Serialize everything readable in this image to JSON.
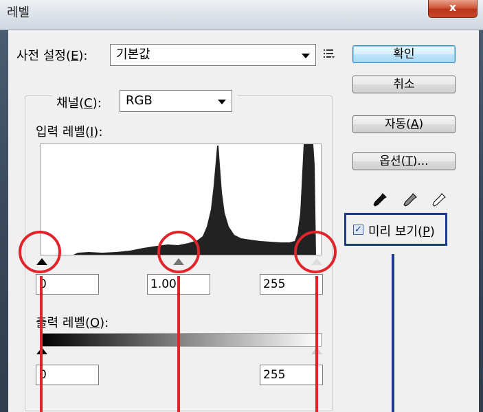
{
  "window": {
    "title": "레벨",
    "close_label": "x"
  },
  "preset": {
    "label": "사전 설정(",
    "label_key": "E",
    "label_end": "):",
    "value": "기본값"
  },
  "channel": {
    "label": "채널(",
    "label_key": "C",
    "label_end": "):",
    "value": "RGB"
  },
  "input_levels": {
    "label": "입력 레벨(",
    "label_key": "I",
    "label_end": "):",
    "black": "0",
    "gamma": "1.00",
    "white": "255"
  },
  "output_levels": {
    "label": "출력 레벨(",
    "label_key": "O",
    "label_end": "):",
    "black": "0",
    "white": "255"
  },
  "buttons": {
    "ok": "확인",
    "cancel": "취소",
    "auto": "자동(",
    "auto_key": "A",
    "auto_end": ")",
    "options": "옵션(",
    "options_key": "T",
    "options_end": ")..."
  },
  "preview": {
    "label": "미리 보기(",
    "label_key": "P",
    "label_end": ")",
    "checked": true
  },
  "icons": {
    "menu": "list-menu-icon",
    "eyedroppers": [
      "black-eyedropper-icon",
      "gray-eyedropper-icon",
      "white-eyedropper-icon"
    ]
  },
  "colors": {
    "annotation_red": "#e0242a",
    "annotation_blue": "#1f3a8c",
    "default_button": "#bee6fd"
  }
}
